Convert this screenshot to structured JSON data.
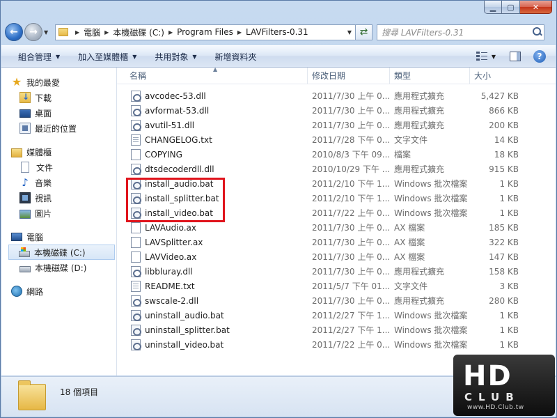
{
  "address": {
    "crumbs": [
      "電腦",
      "本機磁碟 (C:)",
      "Program Files",
      "LAVFilters-0.31"
    ],
    "search_placeholder": "搜尋 LAVFilters-0.31"
  },
  "toolbar": {
    "organize": "組合管理",
    "include_library": "加入至媒體櫃",
    "share_with": "共用對象",
    "new_folder": "新增資料夾"
  },
  "nav": {
    "favorites": "我的最愛",
    "downloads": "下載",
    "desktop": "桌面",
    "recent": "最近的位置",
    "libraries": "媒體櫃",
    "documents": "文件",
    "music": "音樂",
    "videos": "視訊",
    "pictures": "圖片",
    "computer": "電腦",
    "drive_c": "本機磁碟 (C:)",
    "drive_d": "本機磁碟 (D:)",
    "network": "網路"
  },
  "columns": {
    "name": "名稱",
    "date": "修改日期",
    "type": "類型",
    "size": "大小"
  },
  "files": [
    {
      "name": "avcodec-53.dll",
      "date": "2011/7/30 上午 0...",
      "type": "應用程式擴充",
      "size": "5,427 KB",
      "icon": "dll"
    },
    {
      "name": "avformat-53.dll",
      "date": "2011/7/30 上午 0...",
      "type": "應用程式擴充",
      "size": "866 KB",
      "icon": "dll"
    },
    {
      "name": "avutil-51.dll",
      "date": "2011/7/30 上午 0...",
      "type": "應用程式擴充",
      "size": "200 KB",
      "icon": "dll"
    },
    {
      "name": "CHANGELOG.txt",
      "date": "2011/7/28 下午 0...",
      "type": "文字文件",
      "size": "14 KB",
      "icon": "txt"
    },
    {
      "name": "COPYING",
      "date": "2010/8/3 下午 09...",
      "type": "檔案",
      "size": "18 KB",
      "icon": "blank"
    },
    {
      "name": "dtsdecoderdll.dll",
      "date": "2010/10/29 下午 ...",
      "type": "應用程式擴充",
      "size": "915 KB",
      "icon": "dll"
    },
    {
      "name": "install_audio.bat",
      "date": "2011/2/10 下午 1...",
      "type": "Windows 批次檔案",
      "size": "1 KB",
      "icon": "bat"
    },
    {
      "name": "install_splitter.bat",
      "date": "2011/2/10 下午 1...",
      "type": "Windows 批次檔案",
      "size": "1 KB",
      "icon": "bat"
    },
    {
      "name": "install_video.bat",
      "date": "2011/7/22 上午 0...",
      "type": "Windows 批次檔案",
      "size": "1 KB",
      "icon": "bat"
    },
    {
      "name": "LAVAudio.ax",
      "date": "2011/7/30 上午 0...",
      "type": "AX 檔案",
      "size": "185 KB",
      "icon": "blank"
    },
    {
      "name": "LAVSplitter.ax",
      "date": "2011/7/30 上午 0...",
      "type": "AX 檔案",
      "size": "322 KB",
      "icon": "blank"
    },
    {
      "name": "LAVVideo.ax",
      "date": "2011/7/30 上午 0...",
      "type": "AX 檔案",
      "size": "147 KB",
      "icon": "blank"
    },
    {
      "name": "libbluray.dll",
      "date": "2011/7/30 上午 0...",
      "type": "應用程式擴充",
      "size": "158 KB",
      "icon": "dll"
    },
    {
      "name": "README.txt",
      "date": "2011/5/7 下午 01...",
      "type": "文字文件",
      "size": "3 KB",
      "icon": "txt"
    },
    {
      "name": "swscale-2.dll",
      "date": "2011/7/30 上午 0...",
      "type": "應用程式擴充",
      "size": "280 KB",
      "icon": "dll"
    },
    {
      "name": "uninstall_audio.bat",
      "date": "2011/2/27 下午 1...",
      "type": "Windows 批次檔案",
      "size": "1 KB",
      "icon": "bat"
    },
    {
      "name": "uninstall_splitter.bat",
      "date": "2011/2/27 下午 1...",
      "type": "Windows 批次檔案",
      "size": "1 KB",
      "icon": "bat"
    },
    {
      "name": "uninstall_video.bat",
      "date": "2011/7/22 上午 0...",
      "type": "Windows 批次檔案",
      "size": "1 KB",
      "icon": "bat"
    }
  ],
  "status": {
    "count": "18 個項目"
  },
  "watermark": {
    "logo": "HD",
    "sub": "CLUB",
    "url": "www.HD.Club.tw"
  },
  "colors": {
    "highlight": "#e0141c",
    "window": "#c7daf0"
  }
}
